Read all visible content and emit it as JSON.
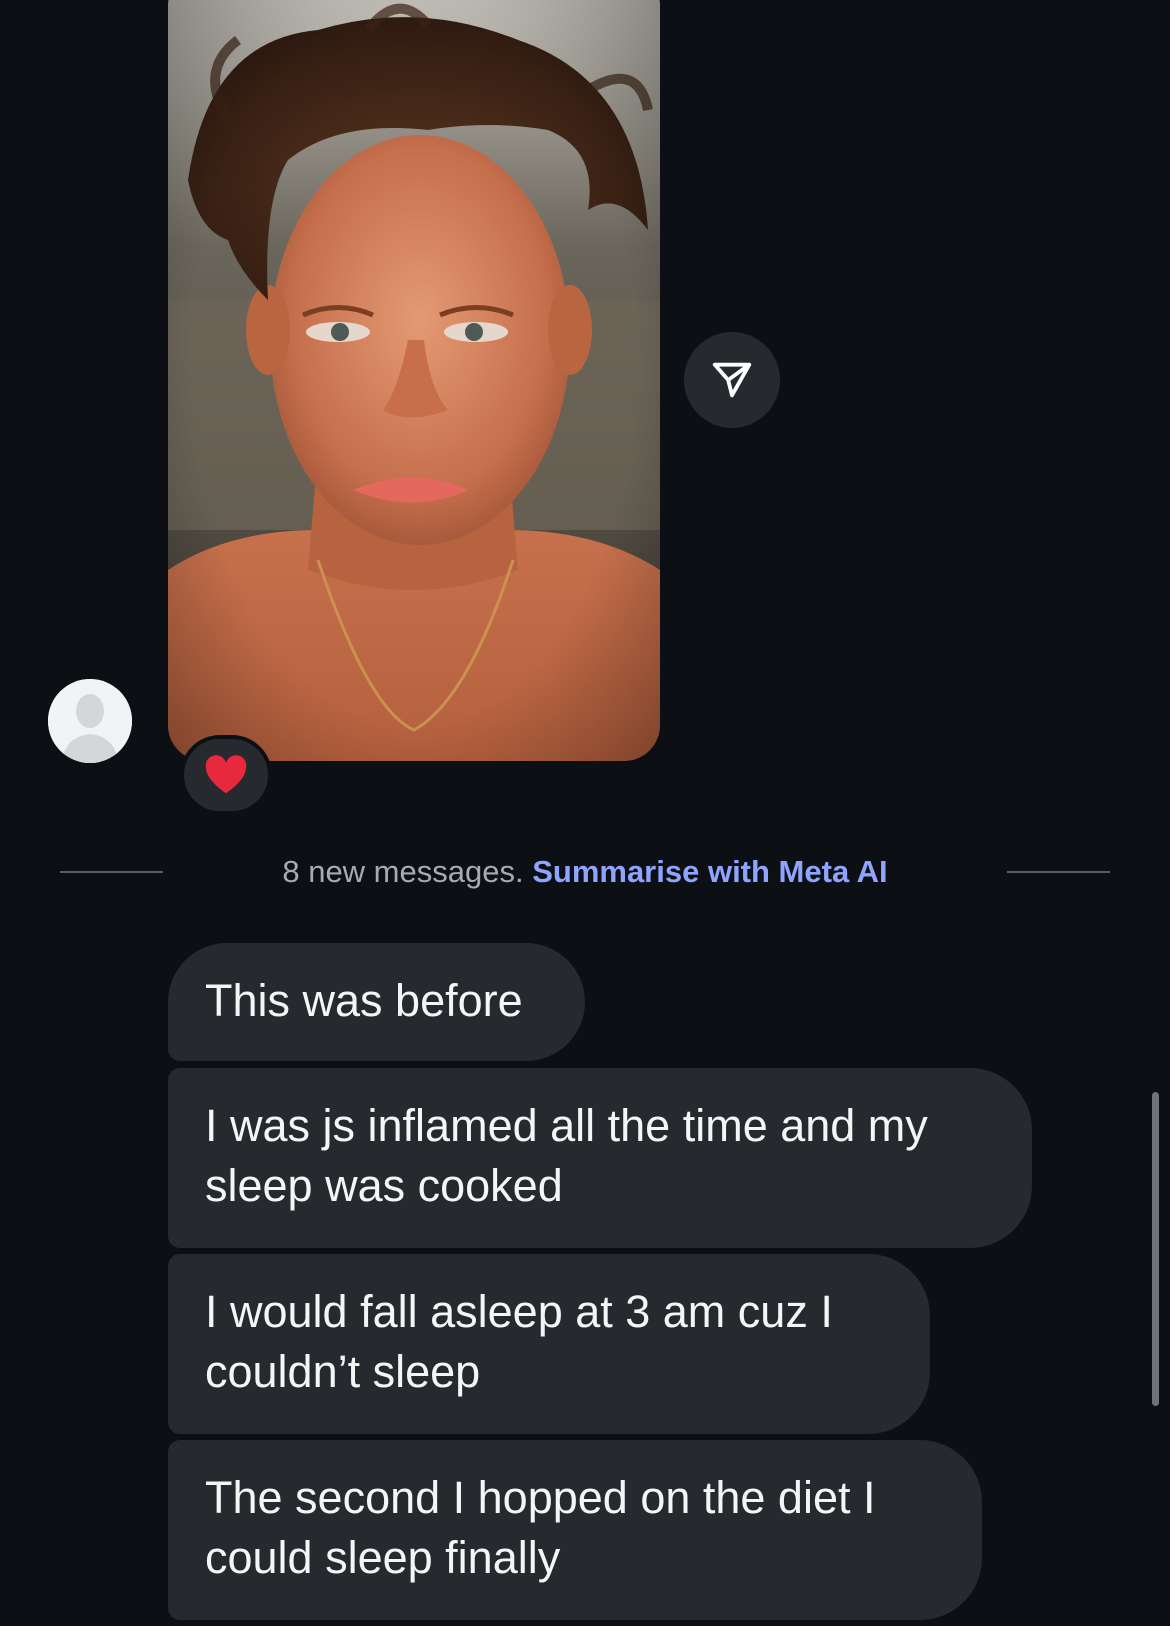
{
  "conversation": {
    "divider": {
      "new_messages_text": "8 new messages.",
      "summarise_link": "Summarise with Meta AI"
    },
    "photo_message": {
      "reaction_emoji": "❤️",
      "share_icon": "send-icon"
    },
    "messages": [
      {
        "line1": "This was before",
        "line2": ""
      },
      {
        "line1": "I was js inflamed all the time and my",
        "line2": "sleep was cooked"
      },
      {
        "line1": "I would fall asleep at 3 am cuz I",
        "line2": "couldn’t sleep"
      },
      {
        "line1": "The second I hopped on the diet I",
        "line2": "could sleep finally"
      }
    ]
  },
  "colors": {
    "background": "#0c1014",
    "bubble": "#262a2f",
    "link": "#8fa4ff",
    "reaction_heart": "#e8283c"
  }
}
